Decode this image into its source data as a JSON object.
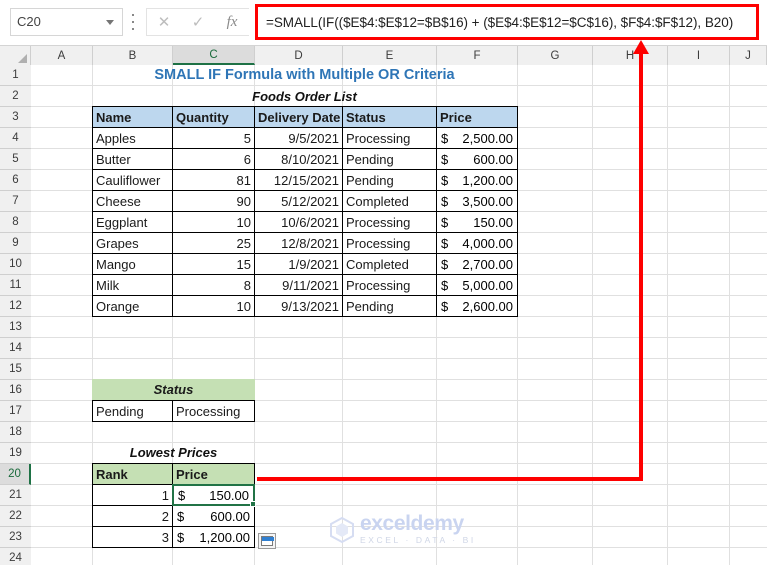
{
  "app": {
    "name_box_value": "C20",
    "formula": "=SMALL(IF(($E$4:$E$12=$B$16) + ($E$4:$E$12=$C$16),  $F$4:$F$12), B20)",
    "cancel_icon": "✕",
    "confirm_icon": "✓",
    "fx_icon": "fx",
    "accent_green": "#217346",
    "annotation_color": "#fe0000",
    "title_color": "#2e75b6",
    "header_blue": "#bdd7ee",
    "header_green": "#c5e0b4"
  },
  "columns": [
    "A",
    "B",
    "C",
    "D",
    "E",
    "F",
    "G",
    "H",
    "I",
    "J"
  ],
  "selected_column": "C",
  "rows": [
    "1",
    "2",
    "3",
    "4",
    "5",
    "6",
    "7",
    "8",
    "9",
    "10",
    "11",
    "12",
    "13",
    "14",
    "15",
    "16",
    "17",
    "18",
    "19",
    "20",
    "21",
    "22",
    "23",
    "24"
  ],
  "selected_row": "20",
  "sheet": {
    "title": "SMALL IF Formula with Multiple OR Criteria",
    "subtitle": "Foods Order List",
    "order_table": {
      "headers": [
        "Name",
        "Quantity",
        "Delivery Date",
        "Status",
        "Price"
      ],
      "rows": [
        {
          "name": "Apples",
          "quantity": "5",
          "date": "9/5/2021",
          "status": "Processing",
          "currency": "$",
          "price": "2,500.00"
        },
        {
          "name": "Butter",
          "quantity": "6",
          "date": "8/10/2021",
          "status": "Pending",
          "currency": "$",
          "price": "600.00"
        },
        {
          "name": "Cauliflower",
          "quantity": "81",
          "date": "12/15/2021",
          "status": "Pending",
          "currency": "$",
          "price": "1,200.00"
        },
        {
          "name": "Cheese",
          "quantity": "90",
          "date": "5/12/2021",
          "status": "Completed",
          "currency": "$",
          "price": "3,500.00"
        },
        {
          "name": "Eggplant",
          "quantity": "10",
          "date": "10/6/2021",
          "status": "Processing",
          "currency": "$",
          "price": "150.00"
        },
        {
          "name": "Grapes",
          "quantity": "25",
          "date": "12/8/2021",
          "status": "Processing",
          "currency": "$",
          "price": "4,000.00"
        },
        {
          "name": "Mango",
          "quantity": "15",
          "date": "1/9/2021",
          "status": "Completed",
          "currency": "$",
          "price": "2,700.00"
        },
        {
          "name": "Milk",
          "quantity": "8",
          "date": "9/11/2021",
          "status": "Processing",
          "currency": "$",
          "price": "5,000.00"
        },
        {
          "name": "Orange",
          "quantity": "10",
          "date": "9/13/2021",
          "status": "Pending",
          "currency": "$",
          "price": "2,600.00"
        }
      ]
    },
    "status_table": {
      "title": "Status",
      "values": [
        "Pending",
        "Processing"
      ]
    },
    "lowest_prices": {
      "title": "Lowest Prices",
      "headers": [
        "Rank",
        "Price"
      ],
      "rows": [
        {
          "rank": "1",
          "currency": "$",
          "price": "150.00"
        },
        {
          "rank": "2",
          "currency": "$",
          "price": "600.00"
        },
        {
          "rank": "3",
          "currency": "$",
          "price": "1,200.00"
        }
      ]
    }
  },
  "watermark": {
    "main": "exceldemy",
    "sub": "EXCEL · DATA · BI"
  }
}
